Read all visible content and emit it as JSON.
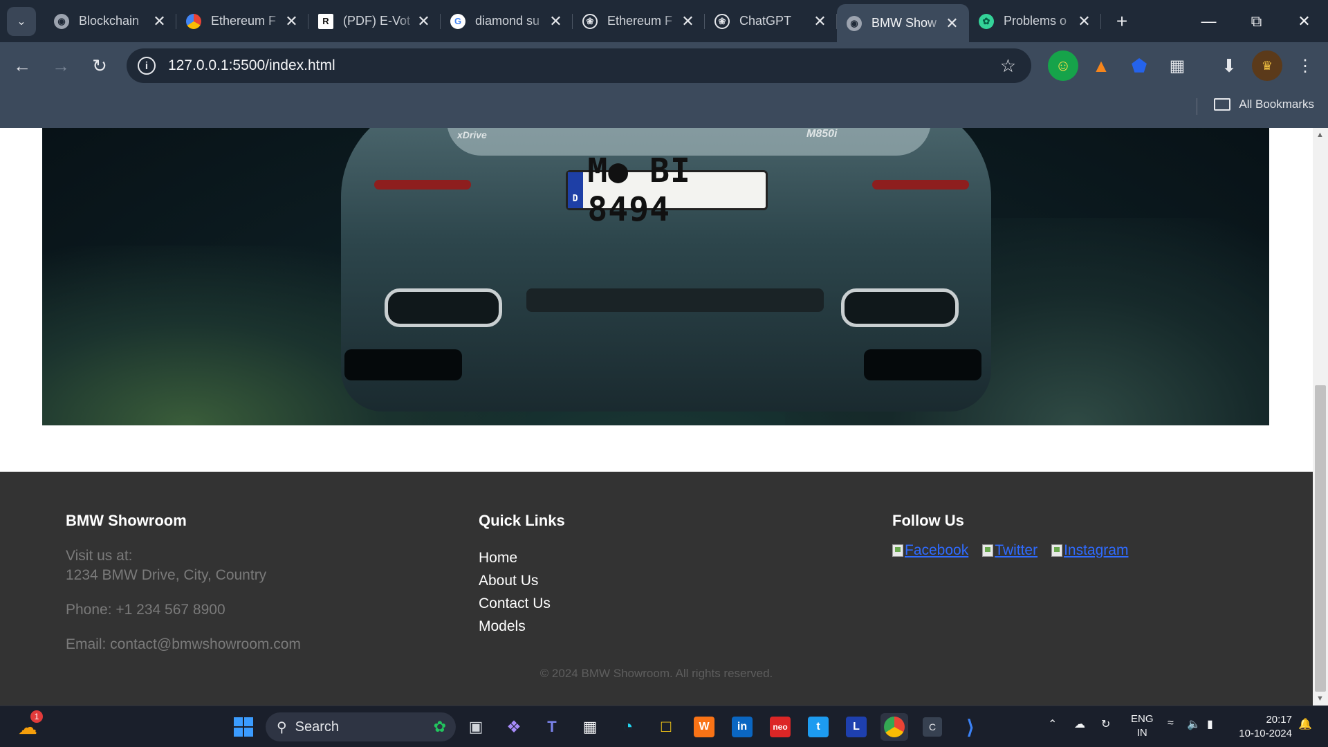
{
  "browser": {
    "tabs": [
      {
        "title": "Blockchain",
        "icon": "globe-icon",
        "active": false
      },
      {
        "title": "Ethereum F",
        "icon": "google-cloud-icon",
        "active": false
      },
      {
        "title": "(PDF) E-Vot",
        "icon": "researchgate-icon",
        "active": false
      },
      {
        "title": "diamond su",
        "icon": "google-icon",
        "active": false
      },
      {
        "title": "Ethereum F",
        "icon": "chatgpt-icon",
        "active": false
      },
      {
        "title": "ChatGPT",
        "icon": "chatgpt-icon",
        "active": false
      },
      {
        "title": "BMW Show",
        "icon": "globe-icon",
        "active": true
      },
      {
        "title": "Problems o",
        "icon": "leaf-icon",
        "active": false
      }
    ],
    "address": "127.0.0.1:5500/index.html",
    "bookmarks_label": "All Bookmarks"
  },
  "page": {
    "hero": {
      "plate_text": "M● BI 8494",
      "plate_country": "D",
      "badge_left": "xDrive",
      "badge_right": "M850i"
    },
    "footer": {
      "brand": {
        "heading": "BMW Showroom",
        "visit_label": "Visit us at:",
        "address": "1234 BMW Drive, City, Country",
        "phone": "Phone: +1 234 567 8900",
        "email": "Email: contact@bmwshowroom.com"
      },
      "quick_links": {
        "heading": "Quick Links",
        "items": [
          "Home",
          "About Us",
          "Contact Us",
          "Models"
        ]
      },
      "follow": {
        "heading": "Follow Us",
        "items": [
          "Facebook",
          "Twitter",
          "Instagram"
        ]
      },
      "copyright": "© 2024 BMW Showroom. All rights reserved."
    }
  },
  "taskbar": {
    "search_label": "Search",
    "weather_badge": "1",
    "lang_top": "ENG",
    "lang_bottom": "IN",
    "time": "20:17",
    "date": "10-10-2024"
  }
}
